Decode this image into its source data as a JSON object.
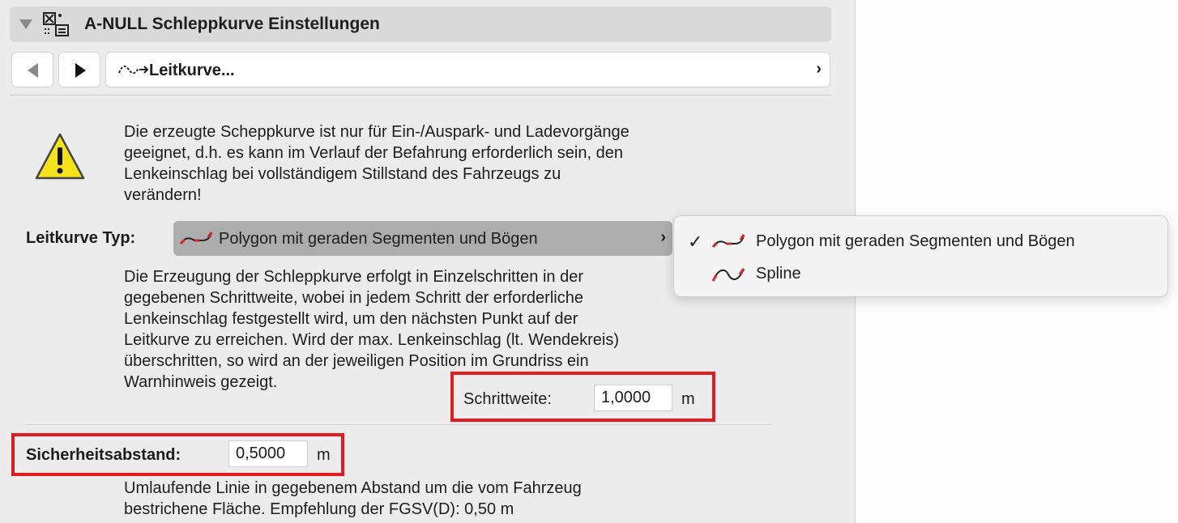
{
  "header": {
    "title": "A-NULL Schleppkurve Einstellungen",
    "icon": "settings-table-icon"
  },
  "nav": {
    "prev_icon": "chevron-left-icon",
    "next_icon": "chevron-right-icon"
  },
  "breadcrumb": {
    "label": "Leitkurve...",
    "icon": "curve-arrow-icon",
    "chevron": "›"
  },
  "warning": {
    "icon": "warning-triangle-icon",
    "text": "Die erzeugte Scheppkurve ist nur für Ein-/Auspark- und Ladevorgänge\ngeeignet, d.h. es kann im Verlauf der Befahrung erforderlich sein, den\nLenkeinschlag bei vollständigem Stillstand des Fahrzeugs zu\nverändern!"
  },
  "leitkurve": {
    "label": "Leitkurve Typ:",
    "selected": "Polygon mit geraden Segmenten und Bögen",
    "chevron": "›",
    "menu": [
      {
        "label": "Polygon mit geraden Segmenten und Bögen",
        "icon": "polygon-curve-icon",
        "checked": true
      },
      {
        "label": "Spline",
        "icon": "spline-curve-icon",
        "checked": false
      }
    ],
    "check": "✓"
  },
  "description": "Die Erzeugung der Schleppkurve erfolgt in Einzelschritten in der\ngegebenen Schrittweite, wobei in jedem Schritt der erforderliche\nLenkeinschlag festgestellt wird, um den nächsten Punkt auf der\nLeitkurve zu erreichen. Wird der max. Lenkeinschlag (lt. Wendekreis)\nüberschritten, so wird an der jeweiligen Position im Grundriss ein\nWarnhinweis gezeigt.",
  "schrittweite": {
    "label": "Schrittweite:",
    "value": "1,0000",
    "unit": "m"
  },
  "sicherheitsabstand": {
    "label": "Sicherheitsabstand:",
    "value": "0,5000",
    "unit": "m"
  },
  "footer": "Umlaufende Linie in gegebenem Abstand um die vom Fahrzeug\nbestrichene Fläche. Empfehlung der FGSV(D): 0,50 m",
  "colors": {
    "highlight": "#e11b22",
    "warning": "#f5e21b",
    "curve": "#d6262a"
  }
}
